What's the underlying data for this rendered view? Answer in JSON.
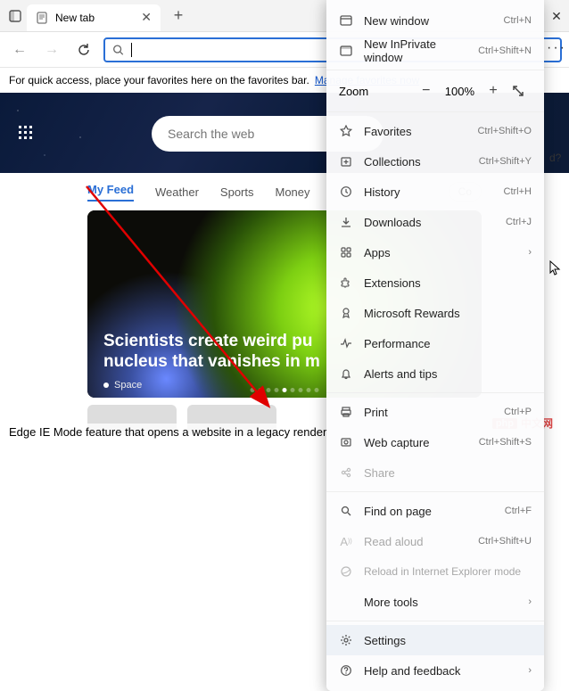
{
  "tabs": {
    "active_title": "New tab"
  },
  "favorites_bar": {
    "prompt": "For quick access, place your favorites here on the favorites bar.",
    "link": "Manage favorites now"
  },
  "ntp": {
    "search_placeholder": "Search the web",
    "feed_tabs": [
      "My Feed",
      "Weather",
      "Sports",
      "Money"
    ],
    "feed_extra": "Co",
    "card": {
      "headline_l1": "Scientists create weird pu",
      "headline_l2": "nucleus that vanishes in m",
      "source": "Space"
    }
  },
  "menu": {
    "new_window": {
      "label": "New window",
      "shortcut": "Ctrl+N"
    },
    "new_inprivate": {
      "label": "New InPrivate window",
      "shortcut": "Ctrl+Shift+N"
    },
    "zoom": {
      "label": "Zoom",
      "value": "100%"
    },
    "favorites": {
      "label": "Favorites",
      "shortcut": "Ctrl+Shift+O"
    },
    "collections": {
      "label": "Collections",
      "shortcut": "Ctrl+Shift+Y"
    },
    "history": {
      "label": "History",
      "shortcut": "Ctrl+H"
    },
    "downloads": {
      "label": "Downloads",
      "shortcut": "Ctrl+J"
    },
    "apps": {
      "label": "Apps"
    },
    "extensions": {
      "label": "Extensions"
    },
    "rewards": {
      "label": "Microsoft Rewards"
    },
    "performance": {
      "label": "Performance"
    },
    "alerts": {
      "label": "Alerts and tips"
    },
    "print": {
      "label": "Print",
      "shortcut": "Ctrl+P"
    },
    "webcapture": {
      "label": "Web capture",
      "shortcut": "Ctrl+Shift+S"
    },
    "share": {
      "label": "Share"
    },
    "find": {
      "label": "Find on page",
      "shortcut": "Ctrl+F"
    },
    "readaloud": {
      "label": "Read aloud",
      "shortcut": "Ctrl+Shift+U"
    },
    "iemode": {
      "label": "Reload in Internet Explorer mode"
    },
    "moretools": {
      "label": "More tools"
    },
    "settings": {
      "label": "Settings"
    },
    "help": {
      "label": "Help and feedback"
    }
  },
  "caption": "Edge IE Mode feature that opens a website in a legacy render",
  "watermark": {
    "brand": "php",
    "text": "中文网"
  }
}
